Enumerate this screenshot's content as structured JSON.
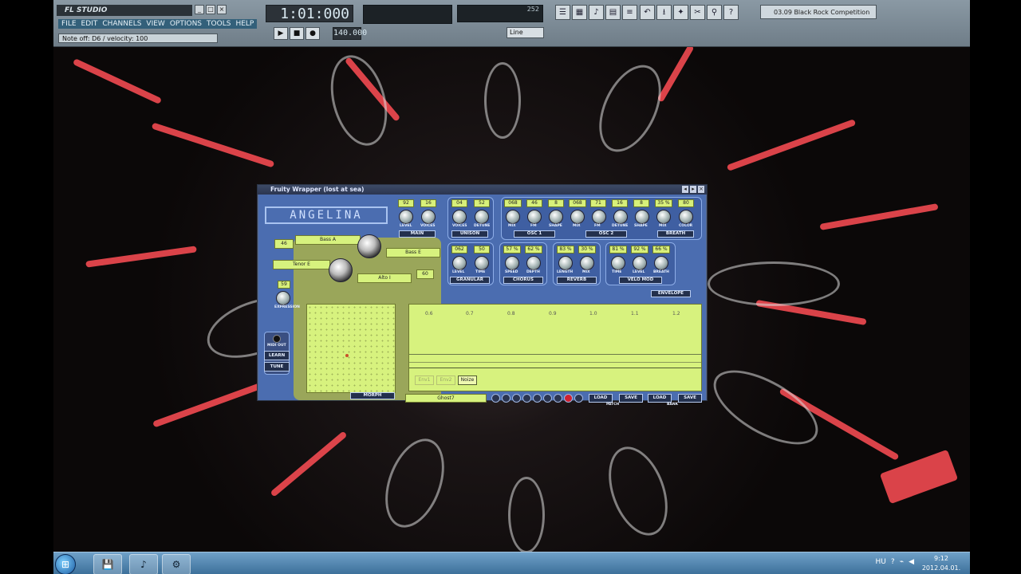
{
  "app": {
    "logo": "FL STUDIO",
    "window_buttons": [
      "_",
      "□",
      "×"
    ],
    "menu": [
      "FILE",
      "EDIT",
      "CHANNELS",
      "VIEW",
      "OPTIONS",
      "TOOLS",
      "HELP"
    ],
    "status_hint": "Note off: D6 / velocity: 100",
    "time_display": "1:01:000",
    "tempo": "140.000",
    "snap_mode": "Line",
    "cpu_label": "252",
    "transport": {
      "play": "▶",
      "stop": "■",
      "record": "●"
    },
    "toolbar_icons": [
      "playlist-icon",
      "step-sequencer-icon",
      "piano-roll-icon",
      "browser-icon",
      "mixer-icon",
      "undo-icon",
      "save-icon",
      "render-icon",
      "tools-icon",
      "search-icon",
      "help-icon"
    ],
    "toolbar_glyphs": [
      "☰",
      "▦",
      "♪",
      "▤",
      "≡",
      "↶",
      "⭳",
      "✦",
      "✂",
      "⚲",
      "?"
    ],
    "hint_box": "03.09 Black Rock Competition"
  },
  "plugin": {
    "title": "Fruity Wrapper (lost at sea)",
    "brand": "ANGELINA",
    "main": {
      "label": "MAIN",
      "values": [
        "92",
        "16"
      ],
      "knobs": [
        "LEVEL",
        "VOICES"
      ]
    },
    "unison": {
      "label": "UNISON",
      "values": [
        "04",
        "52"
      ],
      "knobs": [
        "VOICES",
        "DETUNE"
      ]
    },
    "osc1": {
      "label": "OSC 1",
      "values": [
        "068",
        "46",
        "8"
      ],
      "knobs": [
        "MIX",
        "FM",
        "SHAPE"
      ]
    },
    "osc2": {
      "label": "OSC 2",
      "values": [
        "068",
        "71",
        "16",
        "8"
      ],
      "knobs": [
        "MIX",
        "FM",
        "DETUNE",
        "SHAPE"
      ]
    },
    "breath": {
      "label": "BREATH",
      "values": [
        "35 %",
        "80"
      ],
      "knobs": [
        "MIX",
        "COLOR"
      ]
    },
    "granular": {
      "label": "GRANULAR",
      "values": [
        "062",
        "50"
      ],
      "knobs": [
        "LEVEL",
        "TIME"
      ]
    },
    "chorus": {
      "label": "CHORUS",
      "values": [
        "57 %",
        "62 %"
      ],
      "knobs": [
        "SPEED",
        "DEPTH"
      ]
    },
    "reverb": {
      "label": "REVERB",
      "values": [
        "83 %",
        "30 %"
      ],
      "knobs": [
        "LENGTH",
        "MIX"
      ]
    },
    "velomod": {
      "label": "VELO MOD",
      "values": [
        "81 %",
        "92 %",
        "66 %"
      ],
      "knobs": [
        "TIME",
        "LEVEL",
        "BREATH"
      ]
    },
    "morph": {
      "label": "MORPH",
      "pad_a": "Bass A",
      "pad_e": "Bass E",
      "tenor": "Tenor E",
      "alto": "Alto I",
      "val_46": "46",
      "val_60": "60",
      "val_59": "59",
      "expression": "EXPRESSION"
    },
    "side": {
      "midi_out": "MIDI OUT",
      "learn": "LEARN",
      "tune": "TUNE"
    },
    "envelope": {
      "label": "ENVELOPE",
      "ticks": [
        "0.6",
        "0.7",
        "0.8",
        "0.9",
        "1.0",
        "1.1",
        "1.2"
      ],
      "modes": [
        "Env1",
        "Env2",
        "Noize"
      ]
    },
    "patch": {
      "name": "Ghost7",
      "load": "LOAD",
      "save": "SAVE",
      "label": "PATCH"
    },
    "bank": {
      "load": "LOAD",
      "save": "SAVE",
      "label": "BANK"
    }
  },
  "taskbar": {
    "start": "⊞",
    "apps": [
      "💾",
      "♪",
      "⚙"
    ],
    "lang": "HU",
    "time": "9:12",
    "date": "2012.04.01."
  },
  "colors": {
    "accent_screen": "#d7f27e",
    "plugin_bg": "#4b6db0",
    "streak": "#ff4d55"
  }
}
